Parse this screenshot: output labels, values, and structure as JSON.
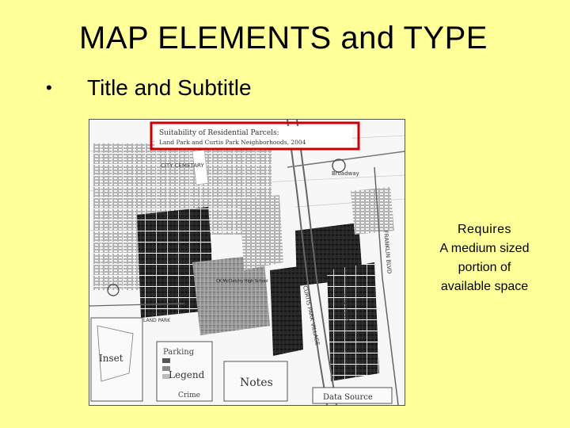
{
  "slide": {
    "title": "MAP ELEMENTS and TYPE",
    "bullet": "•",
    "bullet_text": "Title and Subtitle"
  },
  "map": {
    "title_line1": "Suitability of Residential Parcels:",
    "title_line2": "Land Park and Curtis Park Neighborhoods, 2004",
    "labels": {
      "city_cemetery": "CITY CEMETARY",
      "land_park": "LAND PARK",
      "curtis_park_village": "CURTIS PARK VILLAGE",
      "curtis_park": "CURTIS PARK",
      "franklin_blvd": "FRANKLIN BLVD",
      "broadway": "Broadway",
      "school": "CK McClatchy High School",
      "inset": "Inset",
      "parking": "Parking",
      "legend": "Legend",
      "crime": "Crime",
      "notes": "Notes",
      "data_source": "Data Source"
    },
    "highlight_color": "#cc0000"
  },
  "callout": {
    "head": "Requires",
    "line1": "A medium sized",
    "line2": "portion of",
    "line3": "available space"
  }
}
